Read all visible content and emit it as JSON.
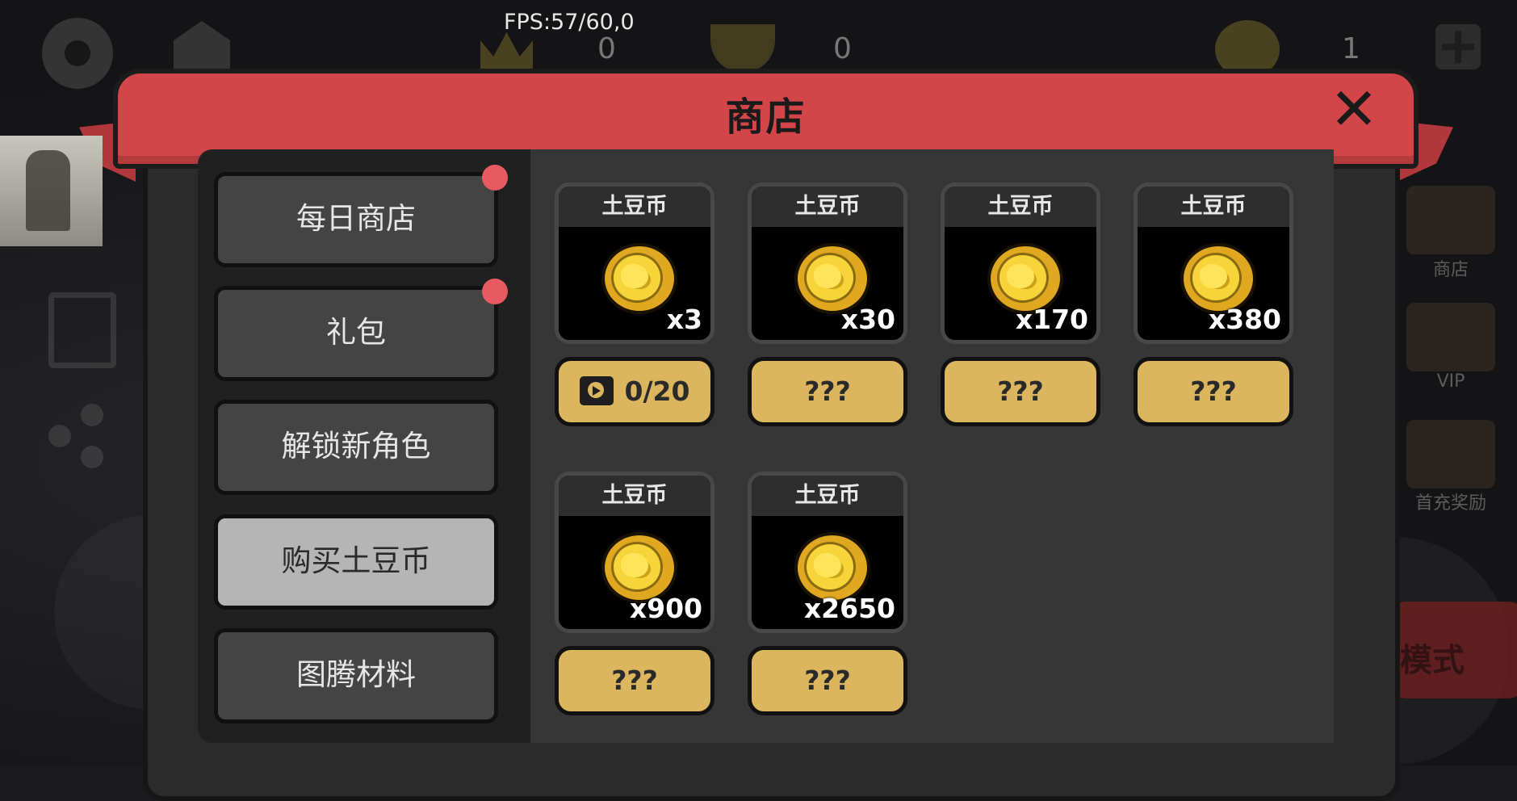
{
  "fps": "FPS:57/60,0",
  "hud": {
    "crown_count": "0",
    "trophy_count": "0",
    "coin_count": "1"
  },
  "side_right": {
    "shop_label": "商店",
    "vip_label": "VIP",
    "first_recharge_label": "首充奖励",
    "mode_label": "模式"
  },
  "modal": {
    "title": "商店",
    "close_label": "✕"
  },
  "tabs": [
    {
      "label": "每日商店",
      "has_badge": true
    },
    {
      "label": "礼包",
      "has_badge": true
    },
    {
      "label": "解锁新角色",
      "has_badge": false
    },
    {
      "label": "购买土豆币",
      "has_badge": false,
      "active": true
    },
    {
      "label": "图腾材料",
      "has_badge": false
    }
  ],
  "products": [
    {
      "name": "土豆币",
      "quantity": "x3",
      "price": "0/20",
      "icon": "potato-coin-icon",
      "price_icon": "video-icon"
    },
    {
      "name": "土豆币",
      "quantity": "x30",
      "price": "???",
      "icon": "potato-coin-icon"
    },
    {
      "name": "土豆币",
      "quantity": "x170",
      "price": "???",
      "icon": "potato-coin-icon"
    },
    {
      "name": "土豆币",
      "quantity": "x380",
      "price": "???",
      "icon": "potato-coin-icon"
    },
    {
      "name": "土豆币",
      "quantity": "x900",
      "price": "???",
      "icon": "potato-coin-icon"
    },
    {
      "name": "土豆币",
      "quantity": "x2650",
      "price": "???",
      "icon": "potato-coin-icon"
    }
  ],
  "colors": {
    "header": "#d24548",
    "button_gold": "#dcb65e",
    "badge": "#e85a62",
    "active_tab": "#b5b5b5"
  }
}
